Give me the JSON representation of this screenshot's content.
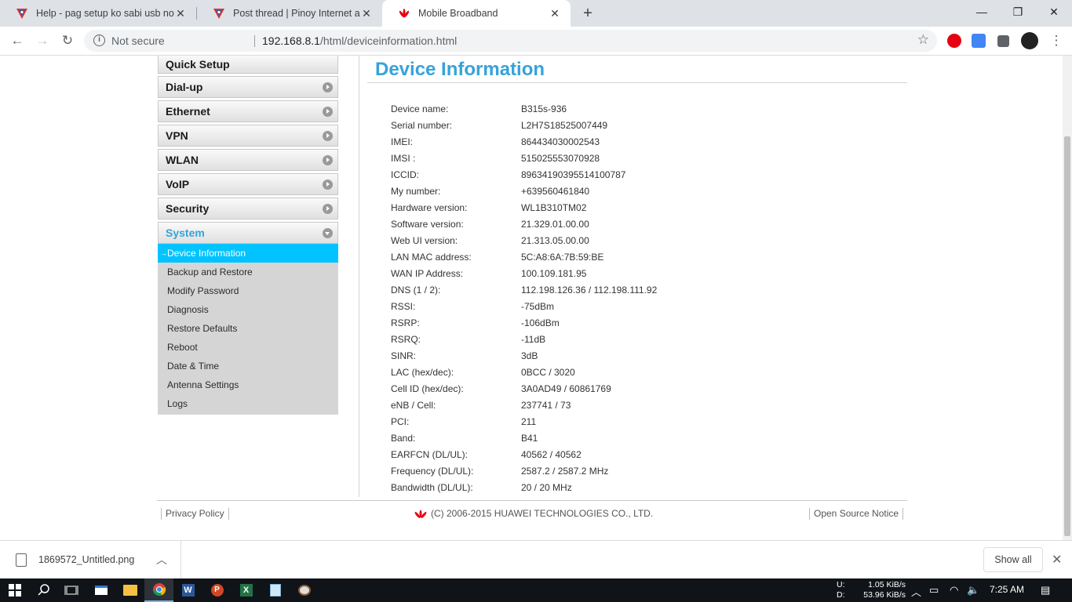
{
  "browser": {
    "tabs": [
      {
        "title": "Help - pag setup ko sabi usb not",
        "active": false
      },
      {
        "title": "Post thread | Pinoy Internet and T",
        "active": false
      },
      {
        "title": "Mobile Broadband",
        "active": true
      }
    ],
    "security_label": "Not secure",
    "url_host": "192.168.8.1",
    "url_path": "/html/deviceinformation.html"
  },
  "sidebar": {
    "items": [
      {
        "label": "Quick Setup"
      },
      {
        "label": "Dial-up"
      },
      {
        "label": "Ethernet"
      },
      {
        "label": "VPN"
      },
      {
        "label": "WLAN"
      },
      {
        "label": "VoIP"
      },
      {
        "label": "Security"
      },
      {
        "label": "System"
      }
    ],
    "system_submenu": [
      "Device Information",
      "Backup and Restore",
      "Modify Password",
      "Diagnosis",
      "Restore Defaults",
      "Reboot",
      "Date & Time",
      "Antenna Settings",
      "Logs"
    ]
  },
  "main": {
    "title": "Device Information",
    "rows": [
      {
        "label": "Device name:",
        "value": "B315s-936"
      },
      {
        "label": "Serial number:",
        "value": "L2H7S18525007449"
      },
      {
        "label": "IMEI:",
        "value": "864434030002543"
      },
      {
        "label": "IMSI :",
        "value": "515025553070928"
      },
      {
        "label": "ICCID:",
        "value": "89634190395514100787"
      },
      {
        "label": "My number:",
        "value": "+639560461840"
      },
      {
        "label": "Hardware version:",
        "value": "WL1B310TM02"
      },
      {
        "label": "Software version:",
        "value": "21.329.01.00.00"
      },
      {
        "label": "Web UI version:",
        "value": "21.313.05.00.00"
      },
      {
        "label": "LAN MAC address:",
        "value": "5C:A8:6A:7B:59:BE"
      },
      {
        "label": "WAN IP Address:",
        "value": "100.109.181.95"
      },
      {
        "label": "DNS (1 / 2):",
        "value": "112.198.126.36 / 112.198.111.92"
      },
      {
        "label": "RSSI:",
        "value": "-75dBm"
      },
      {
        "label": "RSRP:",
        "value": "-106dBm"
      },
      {
        "label": "RSRQ:",
        "value": "-11dB"
      },
      {
        "label": "SINR:",
        "value": "3dB"
      },
      {
        "label": "LAC (hex/dec):",
        "value": "0BCC / 3020"
      },
      {
        "label": "Cell ID (hex/dec):",
        "value": "3A0AD49 / 60861769"
      },
      {
        "label": "eNB / Cell:",
        "value": "237741 / 73"
      },
      {
        "label": "PCI:",
        "value": "211"
      },
      {
        "label": "Band:",
        "value": "B41"
      },
      {
        "label": "EARFCN (DL/UL):",
        "value": "40562 / 40562"
      },
      {
        "label": "Frequency (DL/UL):",
        "value": "2587.2 / 2587.2 MHz"
      },
      {
        "label": "Bandwidth (DL/UL):",
        "value": "20 / 20 MHz"
      }
    ]
  },
  "footer": {
    "privacy": "Privacy Policy",
    "copyright": "(C) 2006-2015 HUAWEI TECHNOLOGIES CO., LTD.",
    "open_source": "Open Source Notice"
  },
  "downloads": {
    "file": "1869572_Untitled.png",
    "show_all": "Show all"
  },
  "taskbar": {
    "net_up_label": "U:",
    "net_up_value": "1.05 KiB/s",
    "net_down_label": "D:",
    "net_down_value": "53.96 KiB/s",
    "time": "7:25 AM"
  },
  "colors": {
    "accent": "#36a3d9",
    "active_menu": "#00c3ff",
    "huawei_red": "#e60012"
  }
}
